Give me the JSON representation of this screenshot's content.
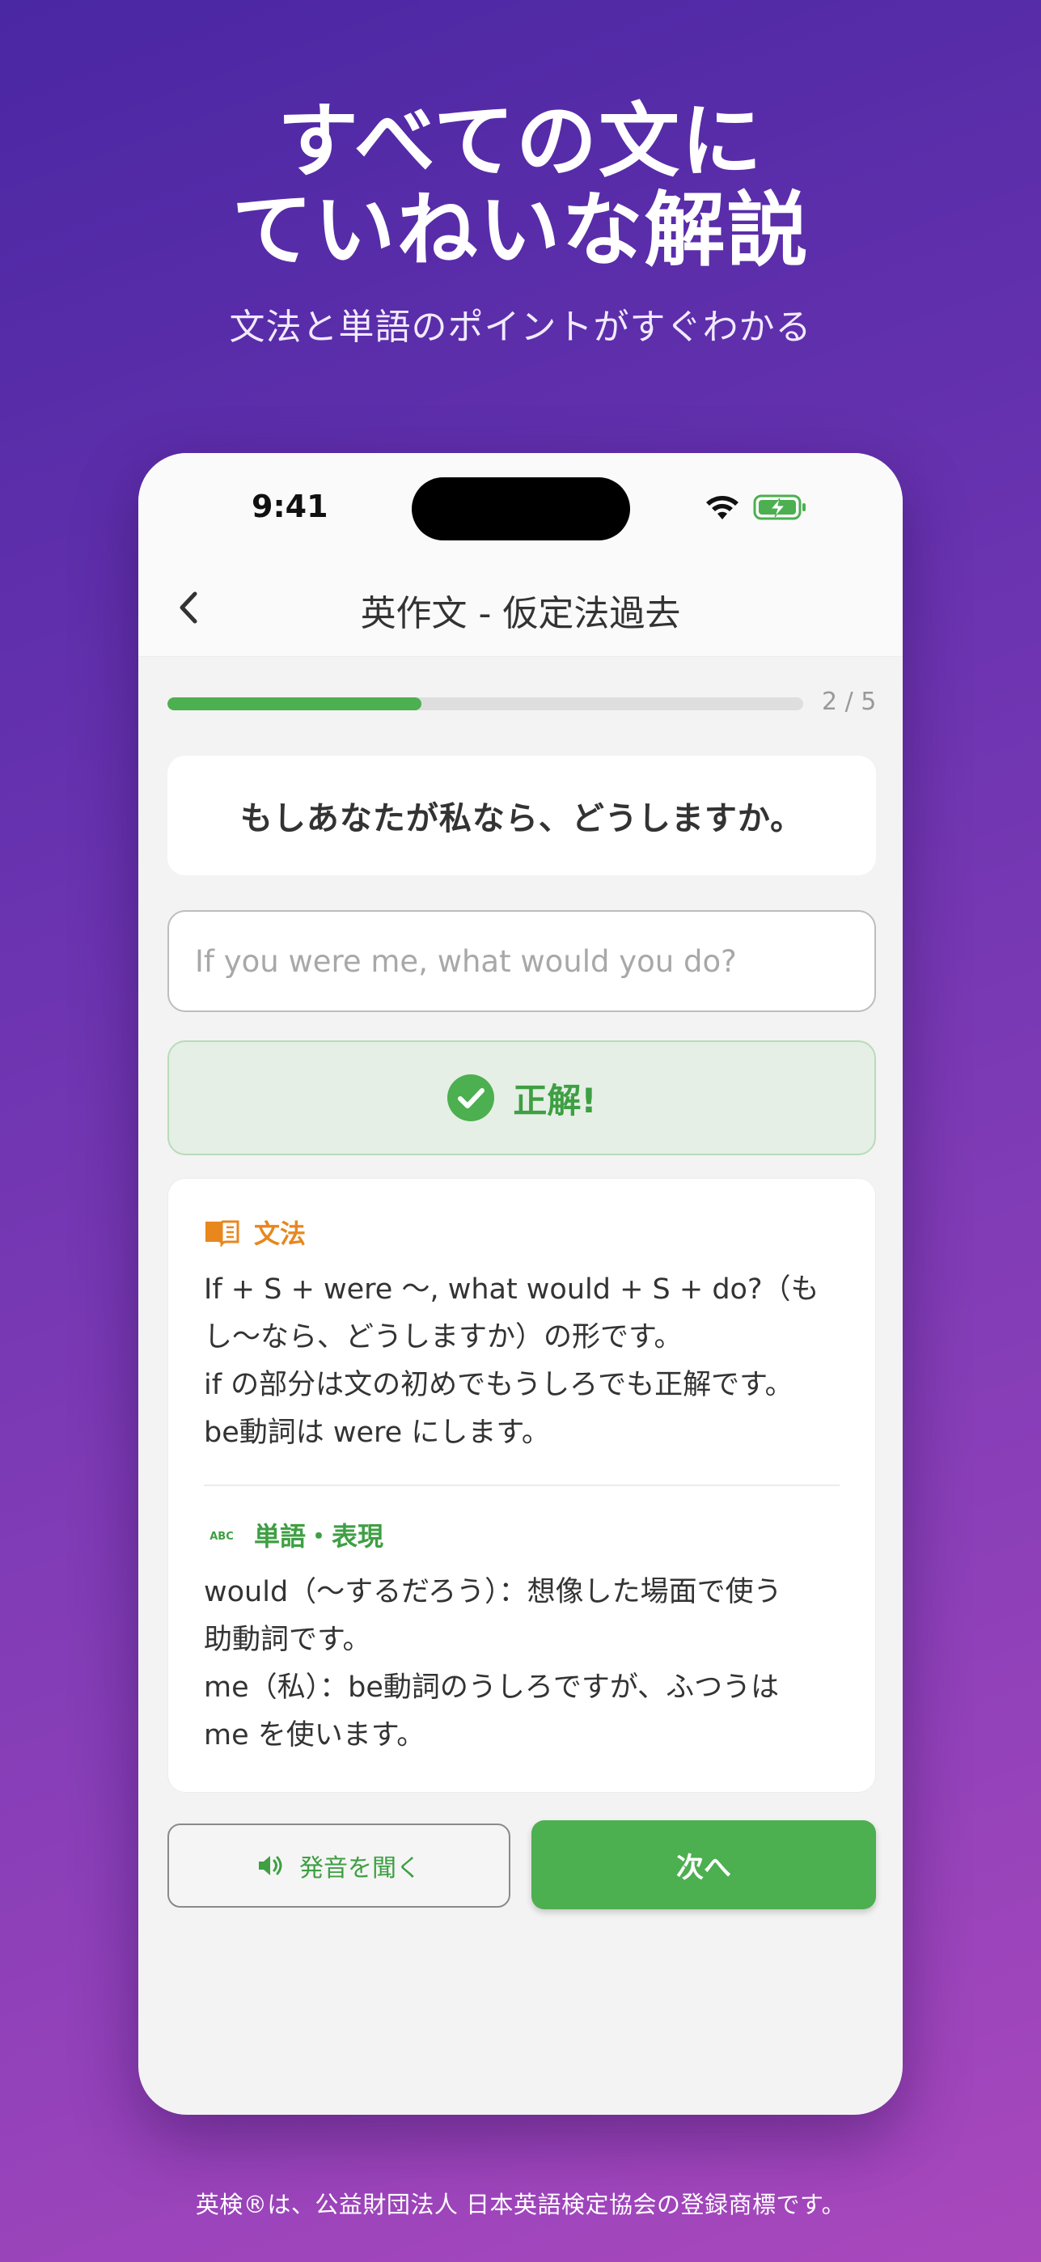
{
  "headline": {
    "line1": "すべての文に",
    "line2": "ていねいな解説",
    "subtitle": "文法と単語のポイントがすぐわかる"
  },
  "status_bar": {
    "time": "9:41",
    "wifi_icon": "wifi-icon",
    "battery_icon": "battery-charging-icon",
    "battery_color": "#4caf50"
  },
  "nav": {
    "back_icon": "chevron-left-icon",
    "title": "英作文 - 仮定法過去"
  },
  "progress": {
    "fraction": 0.4,
    "count": "2 / 5",
    "fill_color": "#4caf50"
  },
  "question": {
    "text": "もしあなたが私なら、どうしますか。"
  },
  "answer": {
    "value": "",
    "placeholder": "If you were me, what would you do?"
  },
  "result": {
    "icon": "check-circle-icon",
    "text": "正解!",
    "color": "#3e9f43"
  },
  "explanation": {
    "grammar": {
      "icon": "book-icon",
      "title": "文法",
      "lines": [
        "If + S + were 〜, what would + S + do?（も",
        "し〜なら、どうしますか）の形です。",
        "if の部分は文の初めでもうしろでも正解です。",
        "be動詞は were にします。"
      ]
    },
    "vocab": {
      "icon": "abc-icon",
      "title": "単語・表現",
      "lines": [
        "would（〜するだろう）：想像した場面で使う",
        "助動詞です。",
        "me（私）：be動詞のうしろですが、ふつうは",
        "me を使います。"
      ]
    }
  },
  "buttons": {
    "sound_icon": "speaker-icon",
    "sound_label": "発音を聞く",
    "next_label": "次へ"
  },
  "footer": {
    "note": "英検®は、公益財団法人 日本英語検定協会の登録商標です。"
  }
}
